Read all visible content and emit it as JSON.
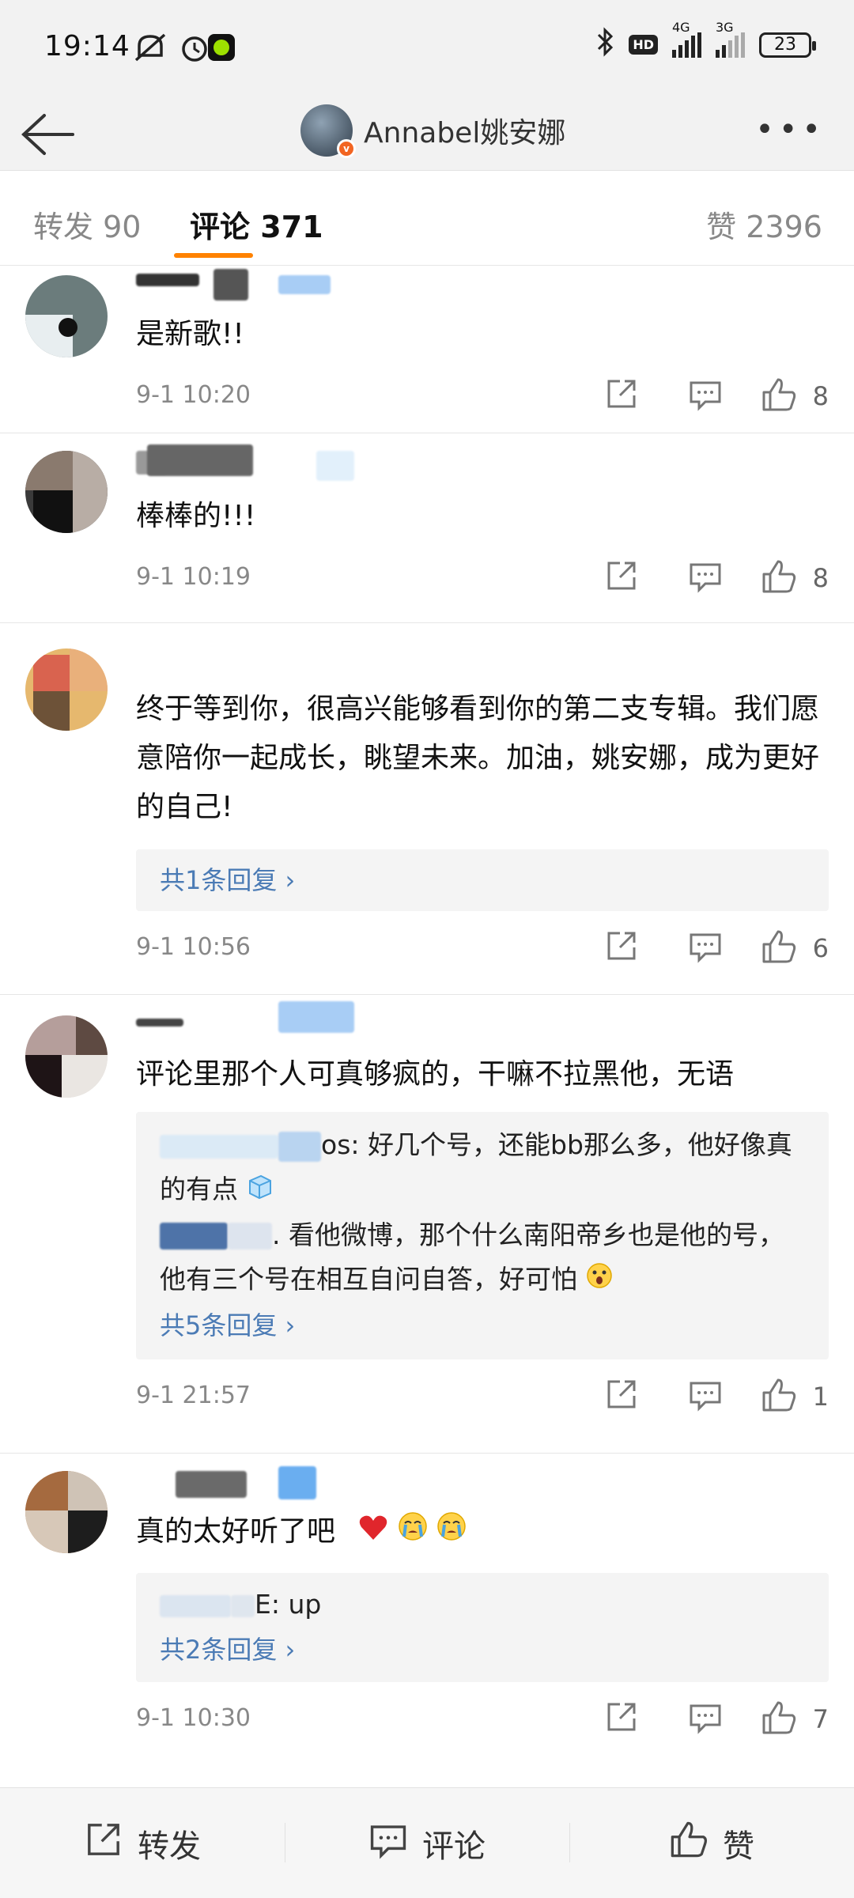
{
  "status_bar": {
    "time": "19:14",
    "net1": "4G",
    "net2": "3G",
    "battery": "23"
  },
  "header": {
    "title": "Annabel姚安娜",
    "verified_badge": "v"
  },
  "tabs": [
    {
      "label": "转发",
      "count": "90"
    },
    {
      "label": "评论",
      "count": "371"
    },
    {
      "label": "赞",
      "count": "2396"
    }
  ],
  "comments": [
    {
      "text": "是新歌!!",
      "time": "9-1 10:20",
      "likes": "8"
    },
    {
      "text": "棒棒的!!!",
      "time": "9-1 10:19",
      "likes": "8"
    },
    {
      "text": "终于等到你，很高兴能够看到你的第二支专辑。我们愿意陪你一起成长，眺望未来。加油，姚安娜，成为更好的自己!",
      "time": "9-1 10:56",
      "likes": "6",
      "reply_link": "共1条回复"
    },
    {
      "text": "评论里那个人可真够疯的，干嘛不拉黑他，无语",
      "time": "9-1 21:57",
      "likes": "1",
      "replies": [
        {
          "tail": "os: 好几个号，还能bb那么多，他好像真的有点"
        },
        {
          "tail": ". 看他微博，那个什么南阳帝乡也是他的号，他有三个号在相互自问自答，好可怕"
        }
      ],
      "reply_link": "共5条回复"
    },
    {
      "text": "真的太好听了吧",
      "time": "9-1 10:30",
      "likes": "7",
      "replies": [
        {
          "tail": "E: up"
        }
      ],
      "reply_link": "共2条回复"
    }
  ],
  "bottom_bar": {
    "repost": "转发",
    "comment": "评论",
    "like": "赞"
  },
  "colors": {
    "accent": "#ff8200",
    "link": "#4b7bb5"
  }
}
